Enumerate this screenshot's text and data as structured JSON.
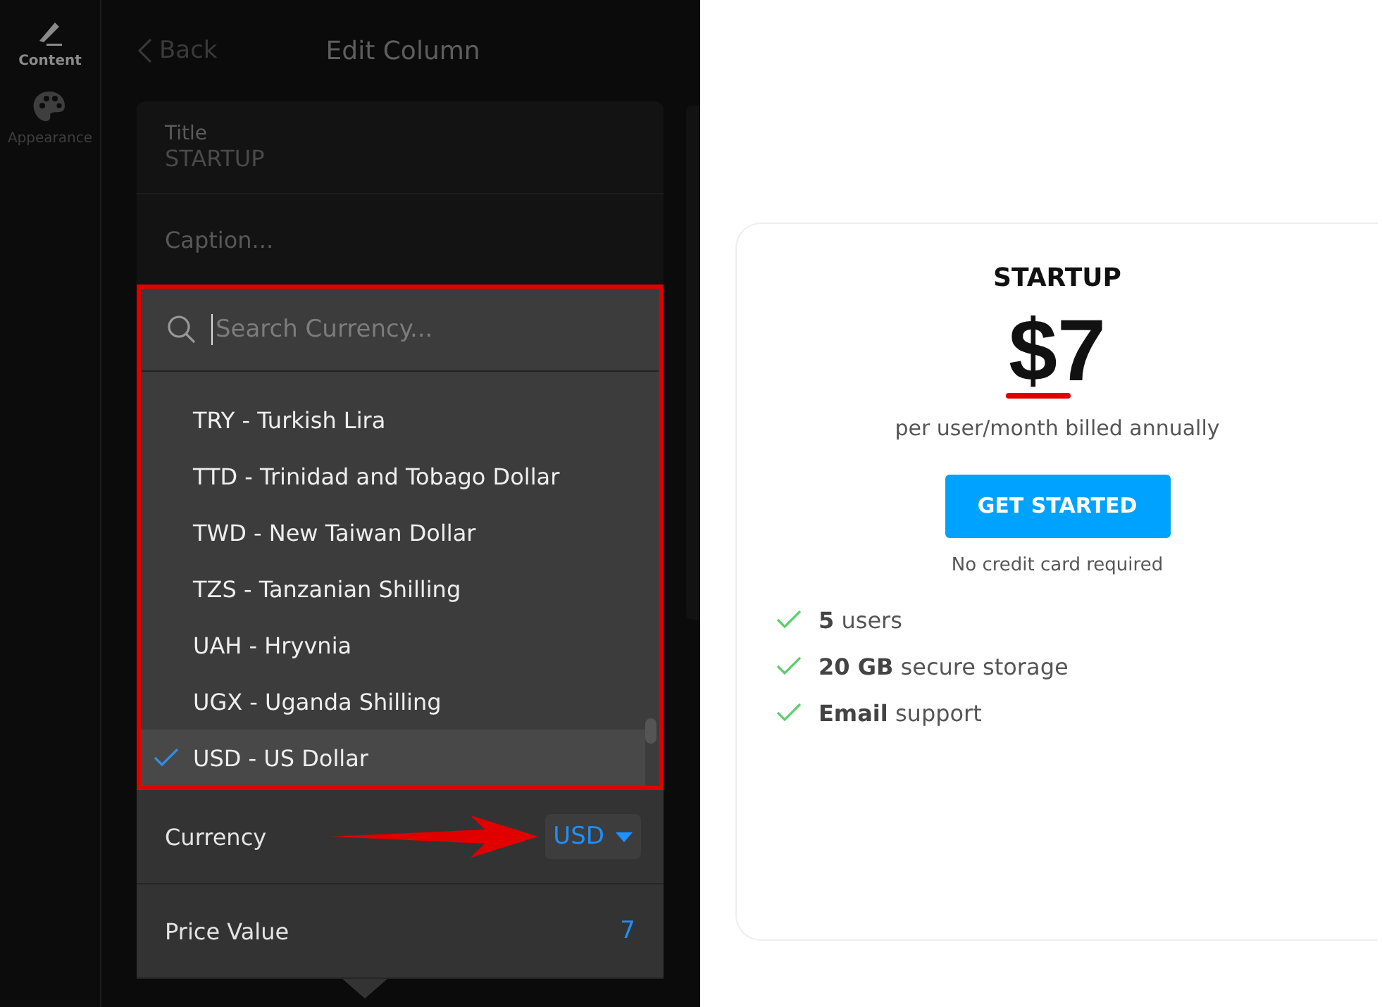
{
  "sidebar": {
    "items": [
      {
        "label": "Content",
        "kind": "pen",
        "selected": true
      },
      {
        "label": "Appearance",
        "kind": "palette",
        "selected": false
      }
    ]
  },
  "header": {
    "back": "Back",
    "title": "Edit Column"
  },
  "form": {
    "title_field": {
      "label": "Title",
      "value": "STARTUP"
    },
    "caption_field": {
      "placeholder": "Caption..."
    }
  },
  "currency_dropdown": {
    "search": {
      "placeholder": "Search Currency..."
    },
    "options": [
      {
        "label": "TRY - Turkish Lira",
        "selected": false
      },
      {
        "label": "TTD - Trinidad and Tobago Dollar",
        "selected": false
      },
      {
        "label": "TWD - New Taiwan Dollar",
        "selected": false
      },
      {
        "label": "TZS - Tanzanian Shilling",
        "selected": false
      },
      {
        "label": "UAH - Hryvnia",
        "selected": false
      },
      {
        "label": "UGX - Uganda Shilling",
        "selected": false
      },
      {
        "label": "USD - US Dollar",
        "selected": true
      }
    ]
  },
  "settings": [
    {
      "kind": "select",
      "label": "Currency",
      "value": "USD"
    },
    {
      "kind": "number",
      "label": "Price Value",
      "value": "7"
    }
  ],
  "preview": {
    "title": "STARTUP",
    "price": "$7",
    "price_note": "per user/month billed annually",
    "button": "GET STARTED",
    "button_note": "No credit card required",
    "features": [
      "**5** users",
      "**20 GB** secure storage",
      "**Email** support"
    ]
  }
}
